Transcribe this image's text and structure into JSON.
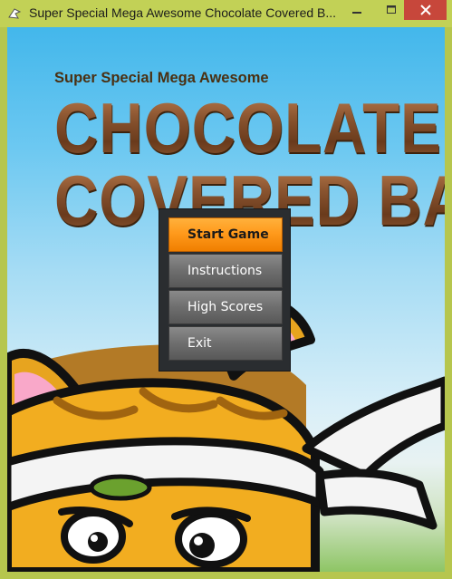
{
  "window": {
    "title": "Super Special Mega Awesome Chocolate Covered B...",
    "minimize_icon": "minimize-icon",
    "maximize_icon": "maximize-icon",
    "close_icon": "close-icon"
  },
  "game": {
    "subtitle": "Super Special Mega Awesome",
    "logo_line1": "CHOCOLATE",
    "logo_line2": "COVERED BALL",
    "background_color": "#6cc8f1"
  },
  "menu": {
    "items": [
      {
        "label": "Start Game",
        "state": "selected"
      },
      {
        "label": "Instructions"
      },
      {
        "label": "High Scores"
      },
      {
        "label": "Exit"
      }
    ],
    "accent": "#ff9a1c"
  }
}
